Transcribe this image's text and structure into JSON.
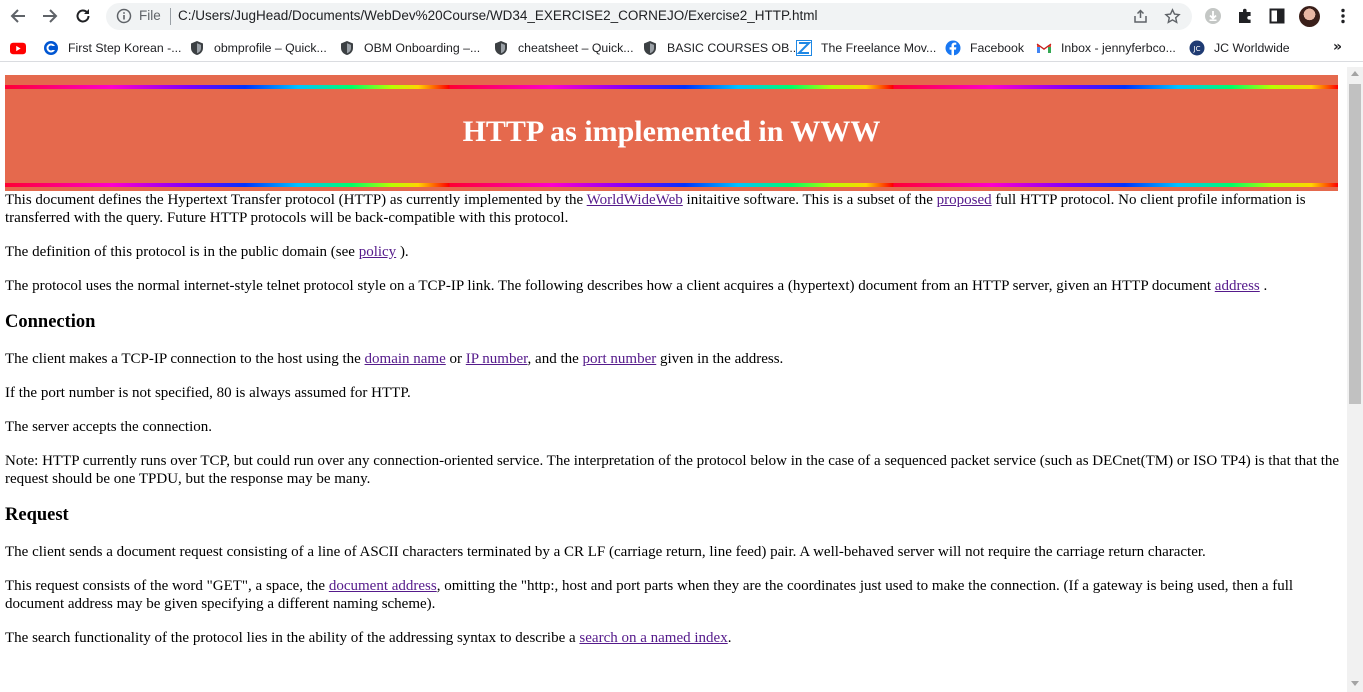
{
  "browser": {
    "file_label": "File",
    "url": "C:/Users/JugHead/Documents/WebDev%20Course/WD34_EXERCISE2_CORNEJO/Exercise2_HTTP.html",
    "bookmarks": [
      {
        "label": "First Step Korean -...",
        "icon": "coursera-icon"
      },
      {
        "label": "obmprofile – Quick...",
        "icon": "shield-icon"
      },
      {
        "label": "OBM Onboarding –...",
        "icon": "shield-icon"
      },
      {
        "label": "cheatsheet – Quick...",
        "icon": "shield-icon"
      },
      {
        "label": "BASIC COURSES OB...",
        "icon": "shield-icon"
      },
      {
        "label": "The Freelance Mov...",
        "icon": "freelance-icon"
      },
      {
        "label": "Facebook",
        "icon": "facebook-icon"
      },
      {
        "label": "Inbox - jennyferbco...",
        "icon": "gmail-icon"
      },
      {
        "label": "JC Worldwide",
        "icon": "jc-icon"
      }
    ],
    "more_bookmarks": "»"
  },
  "page": {
    "title": "HTTP as implemented in WWW",
    "intro": {
      "t1": "This document defines the Hypertext Transfer protocol (HTTP) as currently implemented by the ",
      "link1": "WorldWideWeb",
      "t2": " initaitive software. This is a subset of the ",
      "link2": "proposed",
      "t3": " full HTTP protocol. No client profile information is transferred with the query. Future HTTP protocols will be back-compatible with this protocol."
    },
    "definition": {
      "t1": "The definition of this protocol is in the public domain (see ",
      "link1": "policy",
      "t2": " )."
    },
    "protocol": {
      "t1": "The protocol uses the normal internet-style telnet protocol style on a TCP-IP link. The following describes how a client acquires a (hypertext) document from an HTTP server, given an HTTP document ",
      "link1": "address",
      "t2": " ."
    },
    "connection": {
      "heading": "Connection",
      "p1": {
        "t1": "The client makes a TCP-IP connection to the host using the ",
        "link1": "domain name",
        "t2": " or ",
        "link2": "IP number",
        "t3": ", and the ",
        "link3": "port number",
        "t4": " given in the address."
      },
      "p2": "If the port number is not specified, 80 is always assumed for HTTP.",
      "p3": "The server accepts the connection.",
      "p4": "Note: HTTP currently runs over TCP, but could run over any connection-oriented service. The interpretation of the protocol below in the case of a sequenced packet service (such as DECnet(TM) or ISO TP4) is that that the request should be one TPDU, but the response may be many."
    },
    "request": {
      "heading": "Request",
      "p1": "The client sends a document request consisting of a line of ASCII characters terminated by a CR LF (carriage return, line feed) pair. A well-behaved server will not require the carriage return character.",
      "p2": {
        "t1": "This request consists of the word \"GET\", a space, the ",
        "link1": "document address",
        "t2": ", omitting the \"http:, host and port parts when they are the coordinates just used to make the connection. (If a gateway is being used, then a full document address may be given specifying a different naming scheme)."
      },
      "p3": {
        "t1": "The search functionality of the protocol lies in the ability of the addressing syntax to describe a ",
        "link1": "search on a named index",
        "t2": "."
      }
    }
  },
  "colors": {
    "banner": "#e5694d",
    "link_visited": "#551a8b",
    "banner_text": "#ffffff"
  }
}
